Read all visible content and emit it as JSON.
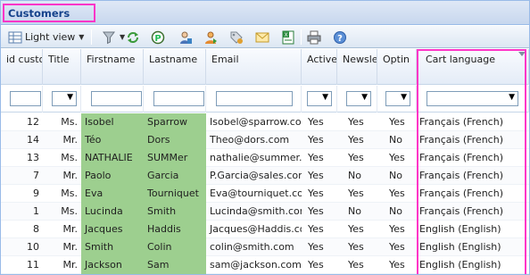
{
  "title": "Customers",
  "toolbar": {
    "view_label": "Light view",
    "icons": [
      "grid-view-icon",
      "filter-icon",
      "refresh-icon",
      "add-customer-icon",
      "edit-customer-icon",
      "group-icon",
      "tag-icon",
      "email-icon",
      "export-excel-icon",
      "print-icon",
      "help-icon"
    ]
  },
  "columns": [
    {
      "key": "id",
      "label": "id custom"
    },
    {
      "key": "title",
      "label": "Title"
    },
    {
      "key": "firstname",
      "label": "Firstname"
    },
    {
      "key": "lastname",
      "label": "Lastname"
    },
    {
      "key": "email",
      "label": "Email"
    },
    {
      "key": "active",
      "label": "Active"
    },
    {
      "key": "newsletter",
      "label": "Newsle"
    },
    {
      "key": "optin",
      "label": "Optin"
    },
    {
      "key": "cartlang",
      "label": "Cart language"
    }
  ],
  "rows": [
    {
      "id": "12",
      "title": "Ms.",
      "firstname": "Isobel",
      "lastname": "Sparrow",
      "email": "Isobel@sparrow.com",
      "active": "Yes",
      "newsletter": "Yes",
      "optin": "Yes",
      "cartlang": "Français (French)"
    },
    {
      "id": "14",
      "title": "Mr.",
      "firstname": "Téo",
      "lastname": "Dors",
      "email": "Theo@dors.com",
      "active": "Yes",
      "newsletter": "Yes",
      "optin": "No",
      "cartlang": "Français (French)"
    },
    {
      "id": "13",
      "title": "Ms.",
      "firstname": "NATHALIE",
      "lastname": "SUMMer",
      "email": "nathalie@summer.c",
      "active": "Yes",
      "newsletter": "Yes",
      "optin": "Yes",
      "cartlang": "Français (French)"
    },
    {
      "id": "7",
      "title": "Mr.",
      "firstname": "Paolo",
      "lastname": "Garcia",
      "email": "P.Garcia@sales.com",
      "active": "Yes",
      "newsletter": "No",
      "optin": "No",
      "cartlang": "Français (French)"
    },
    {
      "id": "9",
      "title": "Ms.",
      "firstname": "Eva",
      "lastname": "Tourniquet",
      "email": "Eva@tourniquet.co",
      "active": "Yes",
      "newsletter": "Yes",
      "optin": "Yes",
      "cartlang": "Français (French)"
    },
    {
      "id": "1",
      "title": "Ms.",
      "firstname": "Lucinda",
      "lastname": "Smith",
      "email": "Lucinda@smith.com",
      "active": "Yes",
      "newsletter": "No",
      "optin": "No",
      "cartlang": "Français (French)"
    },
    {
      "id": "8",
      "title": "Mr.",
      "firstname": "Jacques",
      "lastname": "Haddis",
      "email": "Jacques@Haddis.co",
      "active": "Yes",
      "newsletter": "Yes",
      "optin": "Yes",
      "cartlang": "English (English)"
    },
    {
      "id": "10",
      "title": "Mr.",
      "firstname": "Smith",
      "lastname": "Colin",
      "email": "colin@smith.com",
      "active": "Yes",
      "newsletter": "Yes",
      "optin": "Yes",
      "cartlang": "English (English)"
    },
    {
      "id": "11",
      "title": "Mr.",
      "firstname": "Jackson",
      "lastname": "Sam",
      "email": "sam@jackson.com",
      "active": "Yes",
      "newsletter": "Yes",
      "optin": "Yes",
      "cartlang": "English (English)"
    }
  ],
  "colors": {
    "highlight": "#ff35c8",
    "name_cells": "#9dcf8f",
    "header_text": "#15428b"
  }
}
